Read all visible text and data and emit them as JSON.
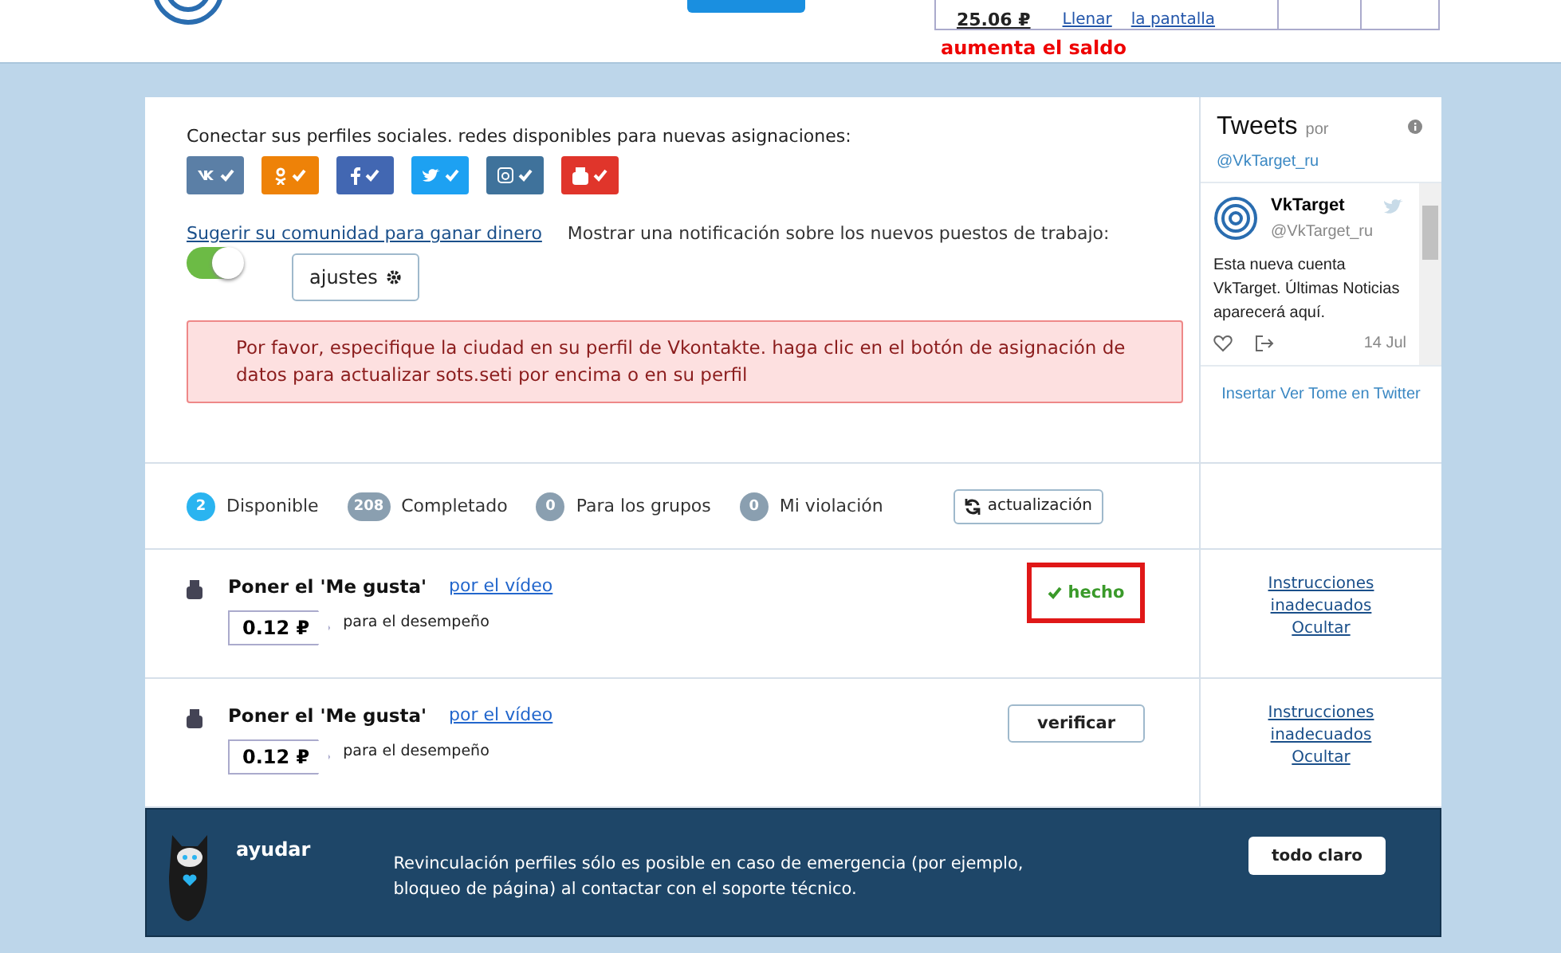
{
  "header": {
    "balance": "25.06 ₽",
    "links": [
      "Llenar",
      "la pantalla"
    ],
    "hint": "aumenta el saldo"
  },
  "social": {
    "title": "Conectar sus perfiles sociales. redes disponibles para nuevas asignaciones:",
    "networks": [
      {
        "kind": "vk",
        "color": "#5b7fa6",
        "connected": true
      },
      {
        "kind": "ok",
        "color": "#ee8208",
        "connected": true
      },
      {
        "kind": "fb",
        "color": "#4267b2",
        "connected": true
      },
      {
        "kind": "tw",
        "color": "#1da1f2",
        "connected": true
      },
      {
        "kind": "ig",
        "color": "#3f729b",
        "connected": true
      },
      {
        "kind": "yt",
        "color": "#e0352b",
        "connected": true
      }
    ]
  },
  "suggest_link": "Sugerir su comunidad para ganar dinero",
  "notify_label": "Mostrar una notificación sobre los nuevos puestos de trabajo:",
  "notify_toggle": {
    "on": true
  },
  "settings_button": "ajustes",
  "alert": "Por favor, especifique la ciudad en su perfil de Vkontakte. haga clic en el botón de asignación de datos para actualizar sots.seti por encima o en su perfil",
  "tweets": {
    "title": "Tweets",
    "by": "por",
    "handle": "@VkTarget_ru",
    "tweet": {
      "name": "VkTarget",
      "handle": "@VkTarget_ru",
      "text": "Esta nueva cuenta VkTarget. Últimas Noticias aparecerá aquí.",
      "date": "14 Jul"
    },
    "embed_link": "Insertar Ver Tome en Twitter"
  },
  "tabs": [
    {
      "count": "2",
      "label": "Disponible",
      "selected": true
    },
    {
      "count": "208",
      "label": "Completado",
      "selected": false
    },
    {
      "count": "0",
      "label": "Para los grupos",
      "selected": false
    },
    {
      "count": "0",
      "label": "Mi violación",
      "selected": false
    }
  ],
  "refresh_button": "actualización",
  "tasks": [
    {
      "title": "Poner el 'Me gusta'",
      "link": "por el vídeo",
      "price": "0.12 ₽",
      "price_note": "para el desempeño",
      "action": {
        "kind": "done",
        "label": "hecho",
        "highlighted": true
      },
      "side_links": [
        "Instrucciones",
        "inadecuados",
        "Ocultar"
      ]
    },
    {
      "title": "Poner el 'Me gusta'",
      "link": "por el vídeo",
      "price": "0.12 ₽",
      "price_note": "para el desempeño",
      "action": {
        "kind": "verify",
        "label": "verificar",
        "highlighted": false
      },
      "side_links": [
        "Instrucciones",
        "inadecuados",
        "Ocultar"
      ]
    }
  ],
  "help": {
    "title": "ayudar",
    "text": "Revinculación perfiles sólo es posible en caso de emergencia (por ejemplo, bloqueo de página) al contactar con el soporte técnico.",
    "button": "todo claro"
  }
}
